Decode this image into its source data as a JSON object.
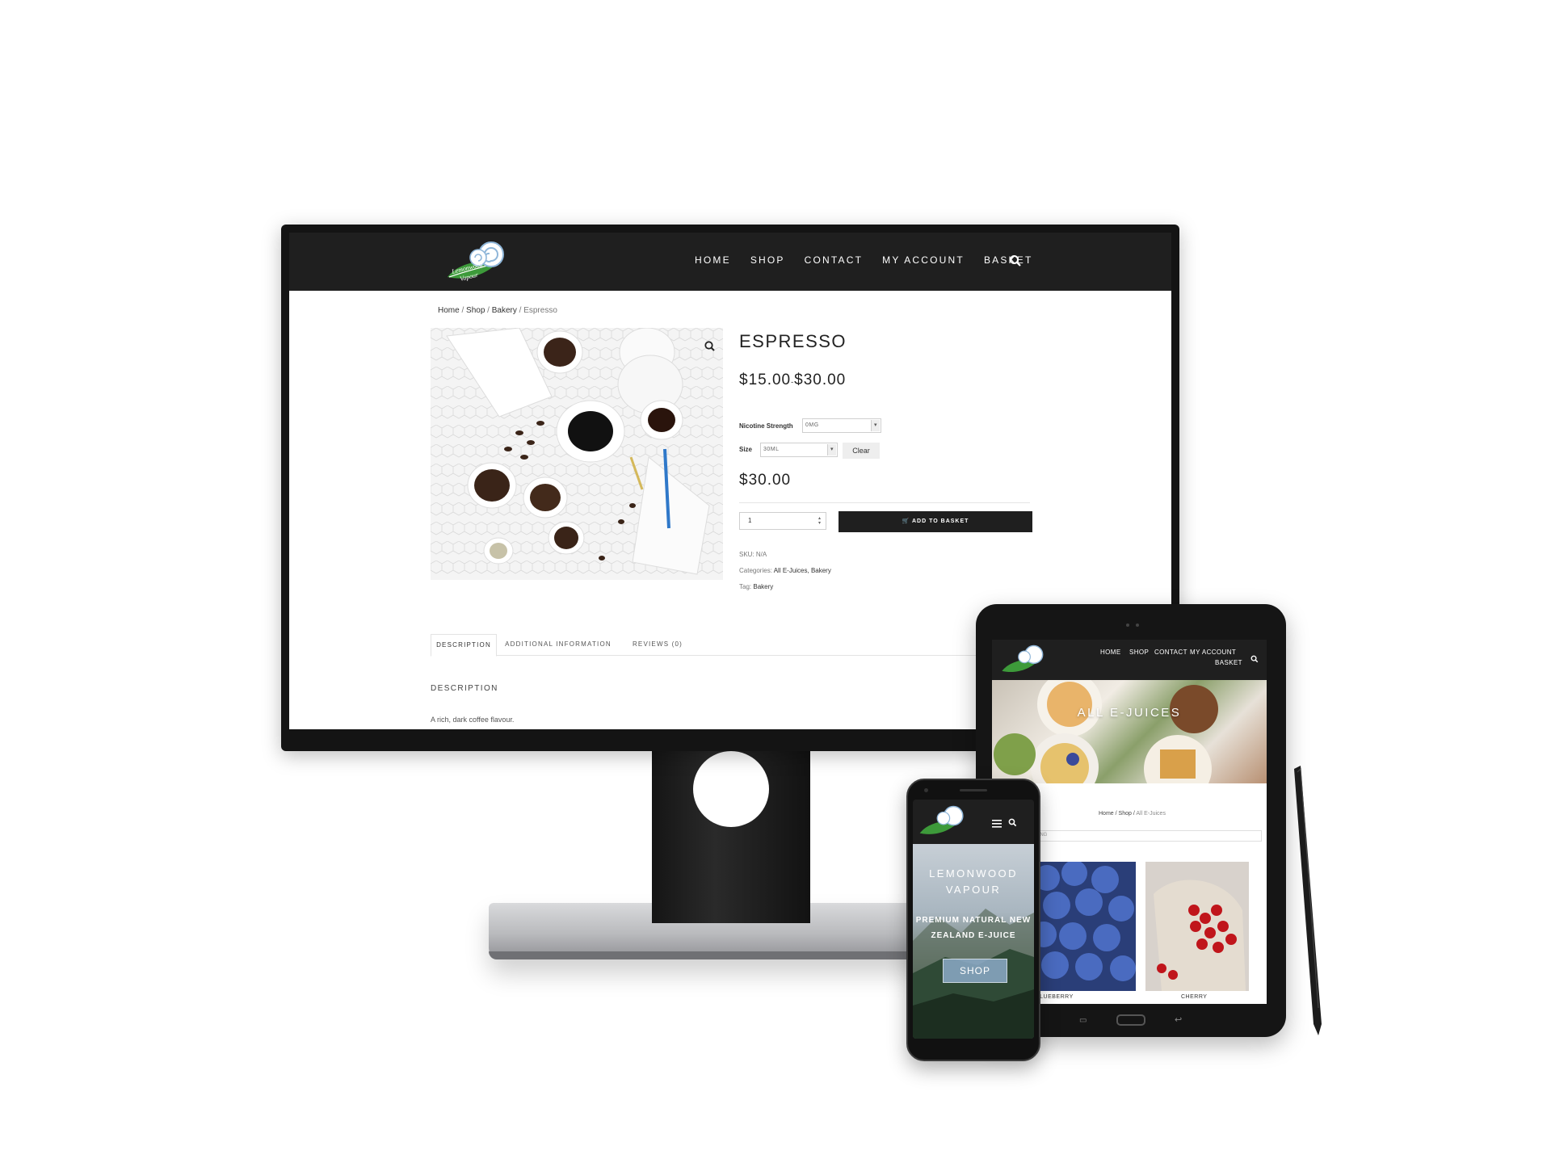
{
  "desktop": {
    "nav": {
      "items": [
        "HOME",
        "SHOP",
        "CONTACT",
        "MY ACCOUNT",
        "BASKET"
      ]
    },
    "breadcrumb": {
      "home": "Home",
      "shop": "Shop",
      "category": "Bakery",
      "current": "Espresso",
      "sep": "/"
    },
    "product": {
      "title": "ESPRESSO",
      "price_low": "$15.00",
      "price_high": "$30.00",
      "price_sep": "-",
      "nicotine_label": "Nicotine Strength",
      "nicotine_value": "0MG",
      "size_label": "Size",
      "size_value": "30ML",
      "clear_label": "Clear",
      "variation_price": "$30.00",
      "quantity": "1",
      "add_to_basket": "ADD TO BASKET",
      "sku_label": "SKU:",
      "sku_value": "N/A",
      "categories_label": "Categories:",
      "categories_value": "All E-Juices, Bakery",
      "tag_label": "Tag:",
      "tag_value": "Bakery"
    },
    "tabs": [
      "DESCRIPTION",
      "ADDITIONAL INFORMATION",
      "REVIEWS (0)"
    ],
    "description": {
      "heading": "DESCRIPTION",
      "text": "A rich, dark coffee flavour."
    }
  },
  "tablet": {
    "nav": {
      "home": "HOME",
      "shop": "SHOP",
      "contact": "CONTACT",
      "my_account": "MY ACCOUNT",
      "basket": "BASKET"
    },
    "hero_title": "ALL E-JUICES",
    "breadcrumb": {
      "home": "Home",
      "shop": "Shop",
      "current": "All E-Juices",
      "sep": "/"
    },
    "sort_fragment": "TING",
    "products": [
      "BLUEBERRY",
      "CHERRY"
    ]
  },
  "phone": {
    "hero_title_line1": "LEMONWOOD",
    "hero_title_line2": "VAPOUR",
    "hero_sub_line1": "PREMIUM NATURAL NEW",
    "hero_sub_line2": "ZEALAND E-JUICE",
    "shop_button": "SHOP"
  },
  "brand": {
    "logo_line1": "Lemonwood",
    "logo_line2": "Vapour",
    "logo_green": "#3d9a3a",
    "nav_bg": "#1f1f1f"
  }
}
